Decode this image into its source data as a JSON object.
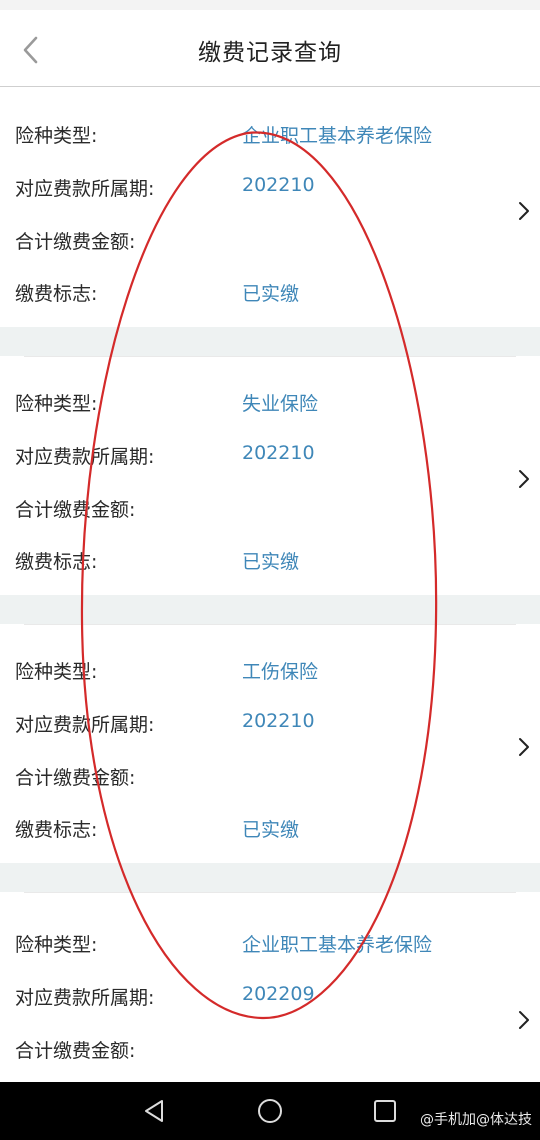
{
  "header": {
    "title": "缴费记录查询"
  },
  "labels": {
    "insurance_type": "险种类型:",
    "period": "对应费款所属期:",
    "total_amount": "合计缴费金额:",
    "payment_flag": "缴费标志:"
  },
  "records": [
    {
      "insurance_type": "企业职工基本养老保险",
      "period": "202210",
      "total_amount": "",
      "payment_flag": "已实缴"
    },
    {
      "insurance_type": "失业保险",
      "period": "202210",
      "total_amount": "",
      "payment_flag": "已实缴"
    },
    {
      "insurance_type": "工伤保险",
      "period": "202210",
      "total_amount": "",
      "payment_flag": "已实缴"
    },
    {
      "insurance_type": "企业职工基本养老保险",
      "period": "202209",
      "total_amount": "",
      "payment_flag": ""
    }
  ],
  "watermark": "@手机加@体达技",
  "colors": {
    "value_text": "#3f87b8",
    "annotation_oval": "#d42a2a",
    "section_gap": "#eef2f2"
  },
  "icons": {
    "back": "back-arrow-icon",
    "row_chevron": "chevron-right-icon",
    "nav_back": "triangle-back-icon",
    "nav_home": "circle-home-icon",
    "nav_recents": "square-recents-icon"
  }
}
